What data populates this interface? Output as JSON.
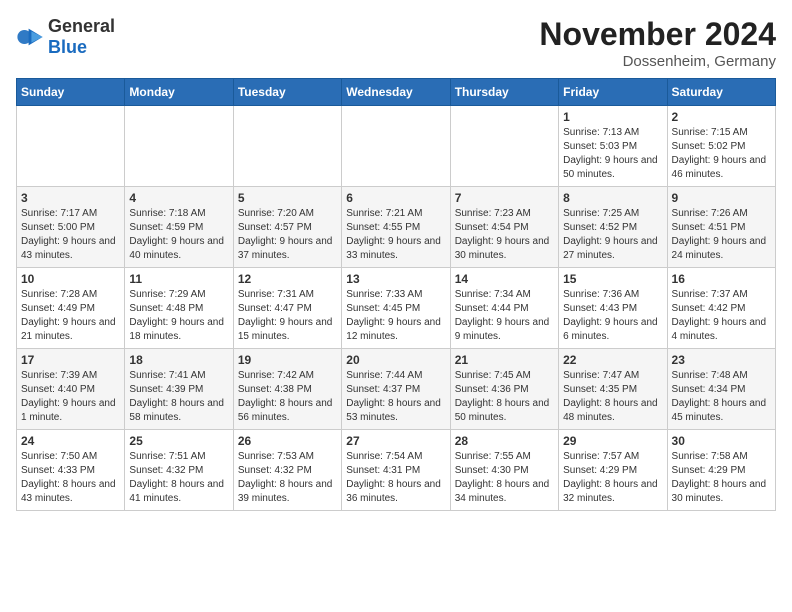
{
  "header": {
    "logo_general": "General",
    "logo_blue": "Blue",
    "month_title": "November 2024",
    "location": "Dossenheim, Germany"
  },
  "weekdays": [
    "Sunday",
    "Monday",
    "Tuesday",
    "Wednesday",
    "Thursday",
    "Friday",
    "Saturday"
  ],
  "weeks": [
    [
      {
        "day": "",
        "info": ""
      },
      {
        "day": "",
        "info": ""
      },
      {
        "day": "",
        "info": ""
      },
      {
        "day": "",
        "info": ""
      },
      {
        "day": "",
        "info": ""
      },
      {
        "day": "1",
        "info": "Sunrise: 7:13 AM\nSunset: 5:03 PM\nDaylight: 9 hours and 50 minutes."
      },
      {
        "day": "2",
        "info": "Sunrise: 7:15 AM\nSunset: 5:02 PM\nDaylight: 9 hours and 46 minutes."
      }
    ],
    [
      {
        "day": "3",
        "info": "Sunrise: 7:17 AM\nSunset: 5:00 PM\nDaylight: 9 hours and 43 minutes."
      },
      {
        "day": "4",
        "info": "Sunrise: 7:18 AM\nSunset: 4:59 PM\nDaylight: 9 hours and 40 minutes."
      },
      {
        "day": "5",
        "info": "Sunrise: 7:20 AM\nSunset: 4:57 PM\nDaylight: 9 hours and 37 minutes."
      },
      {
        "day": "6",
        "info": "Sunrise: 7:21 AM\nSunset: 4:55 PM\nDaylight: 9 hours and 33 minutes."
      },
      {
        "day": "7",
        "info": "Sunrise: 7:23 AM\nSunset: 4:54 PM\nDaylight: 9 hours and 30 minutes."
      },
      {
        "day": "8",
        "info": "Sunrise: 7:25 AM\nSunset: 4:52 PM\nDaylight: 9 hours and 27 minutes."
      },
      {
        "day": "9",
        "info": "Sunrise: 7:26 AM\nSunset: 4:51 PM\nDaylight: 9 hours and 24 minutes."
      }
    ],
    [
      {
        "day": "10",
        "info": "Sunrise: 7:28 AM\nSunset: 4:49 PM\nDaylight: 9 hours and 21 minutes."
      },
      {
        "day": "11",
        "info": "Sunrise: 7:29 AM\nSunset: 4:48 PM\nDaylight: 9 hours and 18 minutes."
      },
      {
        "day": "12",
        "info": "Sunrise: 7:31 AM\nSunset: 4:47 PM\nDaylight: 9 hours and 15 minutes."
      },
      {
        "day": "13",
        "info": "Sunrise: 7:33 AM\nSunset: 4:45 PM\nDaylight: 9 hours and 12 minutes."
      },
      {
        "day": "14",
        "info": "Sunrise: 7:34 AM\nSunset: 4:44 PM\nDaylight: 9 hours and 9 minutes."
      },
      {
        "day": "15",
        "info": "Sunrise: 7:36 AM\nSunset: 4:43 PM\nDaylight: 9 hours and 6 minutes."
      },
      {
        "day": "16",
        "info": "Sunrise: 7:37 AM\nSunset: 4:42 PM\nDaylight: 9 hours and 4 minutes."
      }
    ],
    [
      {
        "day": "17",
        "info": "Sunrise: 7:39 AM\nSunset: 4:40 PM\nDaylight: 9 hours and 1 minute."
      },
      {
        "day": "18",
        "info": "Sunrise: 7:41 AM\nSunset: 4:39 PM\nDaylight: 8 hours and 58 minutes."
      },
      {
        "day": "19",
        "info": "Sunrise: 7:42 AM\nSunset: 4:38 PM\nDaylight: 8 hours and 56 minutes."
      },
      {
        "day": "20",
        "info": "Sunrise: 7:44 AM\nSunset: 4:37 PM\nDaylight: 8 hours and 53 minutes."
      },
      {
        "day": "21",
        "info": "Sunrise: 7:45 AM\nSunset: 4:36 PM\nDaylight: 8 hours and 50 minutes."
      },
      {
        "day": "22",
        "info": "Sunrise: 7:47 AM\nSunset: 4:35 PM\nDaylight: 8 hours and 48 minutes."
      },
      {
        "day": "23",
        "info": "Sunrise: 7:48 AM\nSunset: 4:34 PM\nDaylight: 8 hours and 45 minutes."
      }
    ],
    [
      {
        "day": "24",
        "info": "Sunrise: 7:50 AM\nSunset: 4:33 PM\nDaylight: 8 hours and 43 minutes."
      },
      {
        "day": "25",
        "info": "Sunrise: 7:51 AM\nSunset: 4:32 PM\nDaylight: 8 hours and 41 minutes."
      },
      {
        "day": "26",
        "info": "Sunrise: 7:53 AM\nSunset: 4:32 PM\nDaylight: 8 hours and 39 minutes."
      },
      {
        "day": "27",
        "info": "Sunrise: 7:54 AM\nSunset: 4:31 PM\nDaylight: 8 hours and 36 minutes."
      },
      {
        "day": "28",
        "info": "Sunrise: 7:55 AM\nSunset: 4:30 PM\nDaylight: 8 hours and 34 minutes."
      },
      {
        "day": "29",
        "info": "Sunrise: 7:57 AM\nSunset: 4:29 PM\nDaylight: 8 hours and 32 minutes."
      },
      {
        "day": "30",
        "info": "Sunrise: 7:58 AM\nSunset: 4:29 PM\nDaylight: 8 hours and 30 minutes."
      }
    ]
  ]
}
